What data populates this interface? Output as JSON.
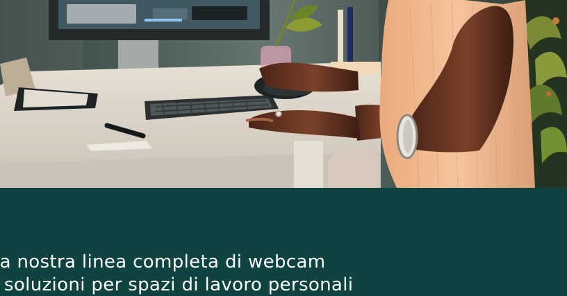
{
  "hero": {
    "scene_icons": [
      "monitor-icon",
      "keyboard-icon",
      "trackball-mouse-icon",
      "plant-icon",
      "notebook-icon",
      "pen-icon",
      "bracelet-icon"
    ],
    "colors": {
      "banner_background": "#0f4341",
      "promo_text": "#ffffff",
      "desk": "#ddd5c8",
      "wall": "#52625f",
      "sweater": "#f1b78e",
      "skin": "#6a3a23"
    }
  },
  "promo": {
    "line_1": "la nostra linea completa di webcam",
    "line_2": "soluzioni per spazi di lavoro personali"
  }
}
